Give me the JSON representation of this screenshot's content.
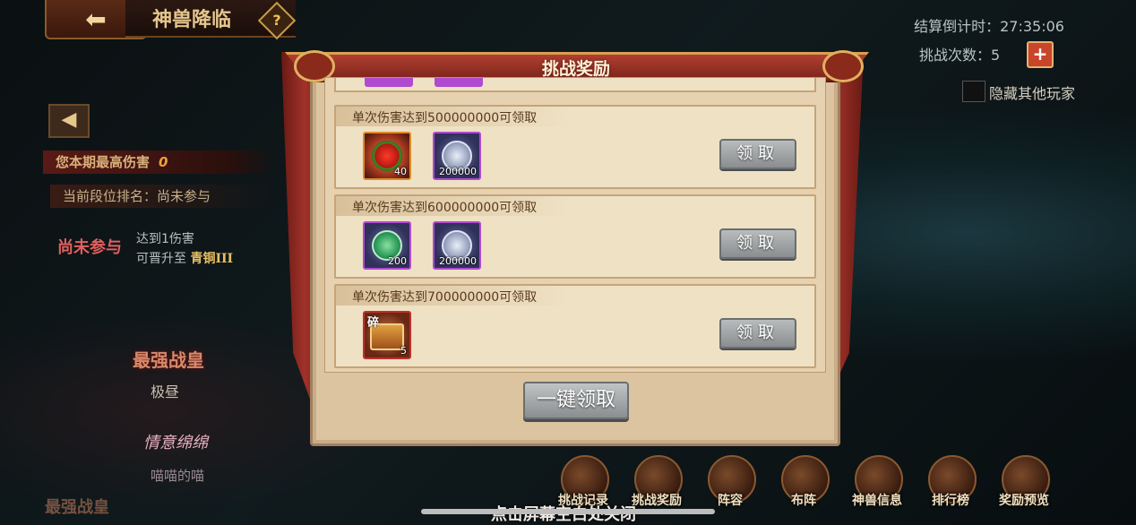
{
  "header": {
    "back_icon": "back-arrow-icon",
    "title": "神兽降临",
    "help_symbol": "?"
  },
  "status": {
    "countdown": "结算倒计时：27:35:06",
    "challenge_count": "挑战次数：5",
    "plus_symbol": "+",
    "hide_players_label": "隐藏其他玩家"
  },
  "left_panel": {
    "collapse_symbol": "◀",
    "max_damage_label": "您本期最高伤害",
    "max_damage_value": "0",
    "rank_label": "当前段位排名：",
    "rank_value": "尚未参与",
    "not_joined": "尚未参与",
    "reach_line1": "达到1伤害",
    "reach_line2": "可晋升至",
    "reach_tier": "青铜III",
    "strongest_title": "最强战皇",
    "player1": "极昼",
    "tag": "情意绵绵",
    "player2": "喵喵的喵",
    "strongest_title_2": "最强战皇"
  },
  "modal": {
    "title": "挑战奖励",
    "rows": [
      {
        "label": "单次伤害达到500000000可领取",
        "items": [
          {
            "icon": "flower-icon",
            "count": "40",
            "frame": "orange"
          },
          {
            "icon": "silver-coin-icon",
            "count": "200000",
            "frame": "purple"
          }
        ],
        "button": "领取"
      },
      {
        "label": "单次伤害达到600000000可领取",
        "items": [
          {
            "icon": "jade-icon",
            "count": "200",
            "frame": "purple"
          },
          {
            "icon": "silver-coin-icon",
            "count": "200000",
            "frame": "purple"
          }
        ],
        "button": "领取"
      },
      {
        "label": "单次伤害达到700000000可领取",
        "items": [
          {
            "icon": "chest-fragment-icon",
            "count": "5",
            "frame": "red",
            "badge": "碎"
          }
        ],
        "button": "领取"
      }
    ],
    "claim_all": "一键领取"
  },
  "bottom_nav": {
    "items": [
      {
        "label": "挑战记录",
        "icon": "scroll-icon"
      },
      {
        "label": "挑战奖励",
        "icon": "chest-icon"
      },
      {
        "label": "阵容",
        "icon": "formation-icon"
      },
      {
        "label": "布阵",
        "icon": "grid-icon"
      },
      {
        "label": "神兽信息",
        "icon": "beast-icon"
      },
      {
        "label": "排行榜",
        "icon": "ranking-icon"
      },
      {
        "label": "奖励预览",
        "icon": "gift-icon"
      }
    ],
    "close_hint": "点击屏幕空白处关闭"
  }
}
